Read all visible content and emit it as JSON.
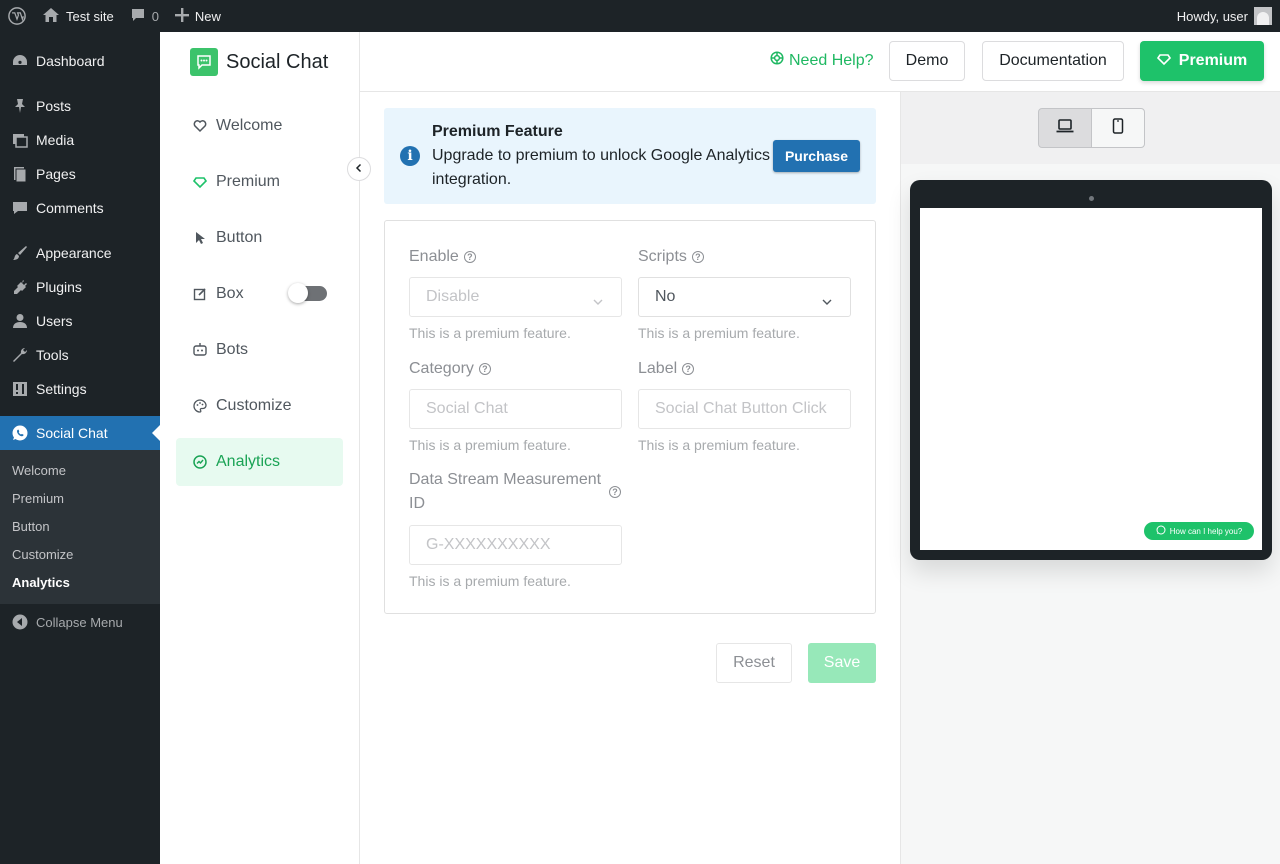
{
  "adminbar": {
    "site_name": "Test site",
    "comments_count": "0",
    "new_label": "New",
    "greeting": "Howdy, user"
  },
  "wp_menu": {
    "items": [
      {
        "label": "Dashboard",
        "icon": "dashboard-icon"
      },
      {
        "label": "Posts",
        "icon": "pin-icon"
      },
      {
        "label": "Media",
        "icon": "media-icon"
      },
      {
        "label": "Pages",
        "icon": "page-icon"
      },
      {
        "label": "Comments",
        "icon": "comment-icon"
      },
      {
        "label": "Appearance",
        "icon": "brush-icon"
      },
      {
        "label": "Plugins",
        "icon": "plug-icon"
      },
      {
        "label": "Users",
        "icon": "user-icon"
      },
      {
        "label": "Tools",
        "icon": "wrench-icon"
      },
      {
        "label": "Settings",
        "icon": "sliders-icon"
      },
      {
        "label": "Social Chat",
        "icon": "whatsapp-icon",
        "active": true
      }
    ],
    "submenu": [
      "Welcome",
      "Premium",
      "Button",
      "Customize",
      "Analytics"
    ],
    "current_submenu": "Analytics",
    "collapse_label": "Collapse Menu"
  },
  "plugin_nav": {
    "brand": "Social Chat",
    "items": [
      {
        "label": "Welcome",
        "icon": "heart-icon"
      },
      {
        "label": "Premium",
        "icon": "diamond-icon"
      },
      {
        "label": "Button",
        "icon": "cursor-icon"
      },
      {
        "label": "Box",
        "icon": "edit-box-icon",
        "toggle": false
      },
      {
        "label": "Bots",
        "icon": "robot-icon"
      },
      {
        "label": "Customize",
        "icon": "palette-icon"
      },
      {
        "label": "Analytics",
        "icon": "analytics-icon",
        "active": true
      }
    ]
  },
  "header": {
    "help_label": "Need Help?",
    "demo_label": "Demo",
    "docs_label": "Documentation",
    "premium_label": "Premium"
  },
  "notice": {
    "title": "Premium Feature",
    "text": "Upgrade to premium to unlock Google Analytics integration.",
    "button": "Purchase"
  },
  "form": {
    "enable": {
      "label": "Enable",
      "value": "Disable",
      "help": "This is a premium feature."
    },
    "scripts": {
      "label": "Scripts",
      "value": "No",
      "help": "This is a premium feature."
    },
    "category": {
      "label": "Category",
      "placeholder": "Social Chat",
      "help": "This is a premium feature."
    },
    "label": {
      "label": "Label",
      "placeholder": "Social Chat Button Click",
      "help": "This is a premium feature."
    },
    "measurement": {
      "label": "Data Stream Measurement ID",
      "placeholder": "G-XXXXXXXXXX",
      "help": "This is a premium feature."
    },
    "reset_label": "Reset",
    "save_label": "Save"
  },
  "preview": {
    "chat_button_text": "How can I help you?",
    "device_selected": "desktop"
  },
  "colors": {
    "brand_green": "#1ec26a",
    "wp_blue": "#2271b1",
    "admin_dark": "#1d2327"
  }
}
